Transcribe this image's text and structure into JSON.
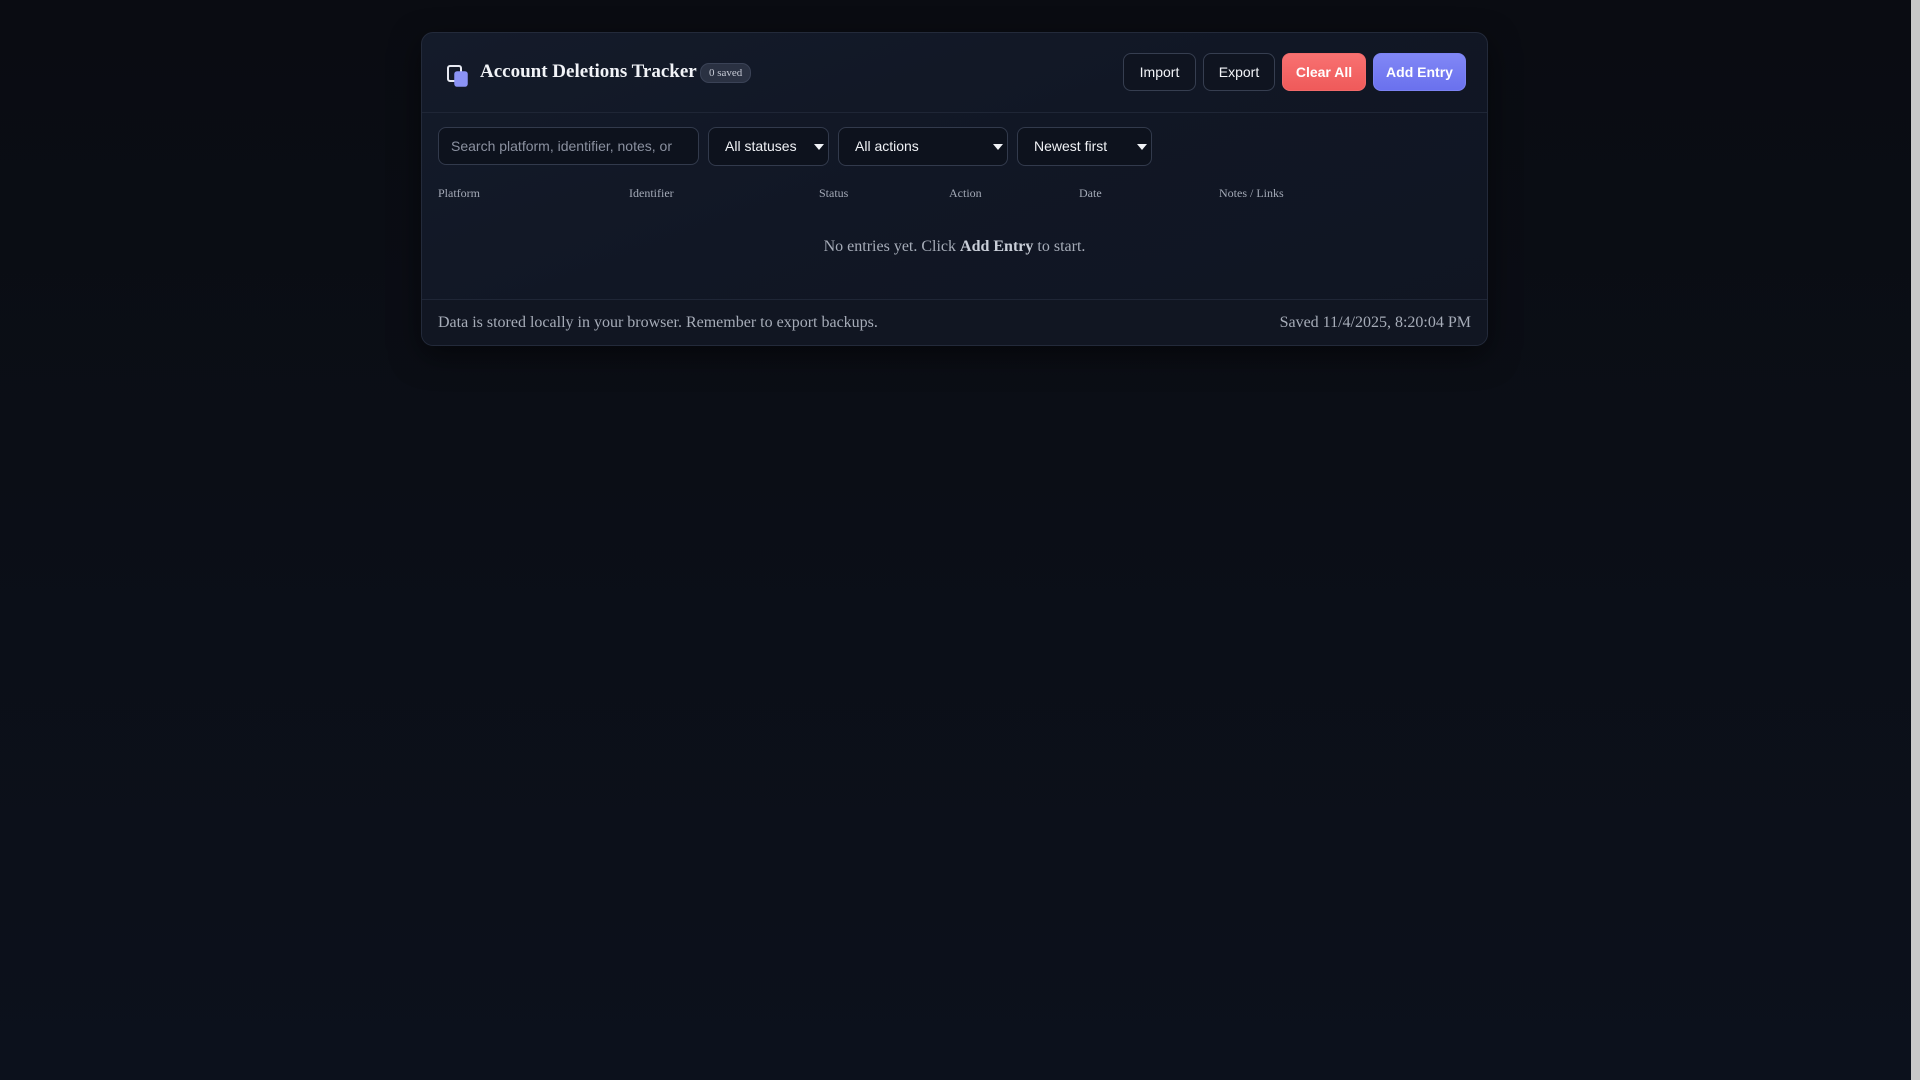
{
  "app": {
    "title": "Account Deletions Tracker",
    "saved_badge": "0 saved",
    "icon": "copy-icon"
  },
  "toolbar": {
    "import_label": "Import",
    "export_label": "Export",
    "clear_label": "Clear All",
    "add_label": "Add Entry"
  },
  "filters": {
    "search_placeholder": "Search platform, identifier, notes, or",
    "search_value": "",
    "status_selected": "All statuses",
    "action_selected": "All actions",
    "sort_selected": "Newest first"
  },
  "table": {
    "columns": [
      "Platform",
      "Identifier",
      "Status",
      "Action",
      "Date",
      "Notes / Links"
    ],
    "empty_prefix": "No entries yet. Click ",
    "empty_emphasis": "Add Entry",
    "empty_suffix": " to start."
  },
  "footer": {
    "note": "Data is stored locally in your browser. Remember to export backups.",
    "saved_at": "Saved 11/4/2025, 8:20:04 PM"
  },
  "colors": {
    "background": "#0b0e16",
    "card": "#131a28",
    "danger": "#f26a6a",
    "accent": "#737af0"
  }
}
